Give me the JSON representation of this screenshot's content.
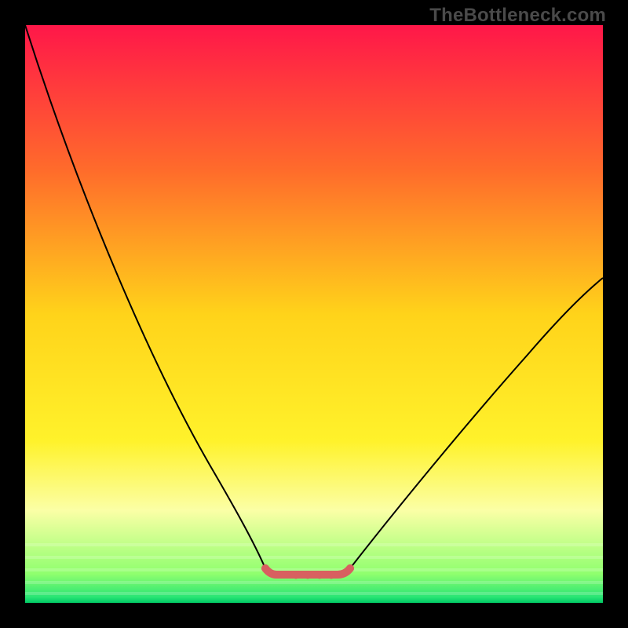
{
  "watermark": "TheBottleneck.com",
  "chart_data": {
    "type": "line",
    "title": "",
    "xlabel": "",
    "ylabel": "",
    "xlim": [
      0,
      1
    ],
    "ylim": [
      0,
      1
    ],
    "grid": false,
    "legend": false,
    "background": {
      "type": "vertical-gradient",
      "stops": [
        {
          "offset": 0.0,
          "color": "#ff1749"
        },
        {
          "offset": 0.25,
          "color": "#ff6b2b"
        },
        {
          "offset": 0.5,
          "color": "#ffd31a"
        },
        {
          "offset": 0.72,
          "color": "#fff22b"
        },
        {
          "offset": 0.84,
          "color": "#fbffa6"
        },
        {
          "offset": 0.96,
          "color": "#8fff6e"
        },
        {
          "offset": 1.0,
          "color": "#00e06a"
        }
      ]
    },
    "series": [
      {
        "name": "left-descent",
        "color": "#000000",
        "width": 2,
        "x": [
          0.0,
          0.415
        ],
        "y": [
          1.0,
          0.06
        ],
        "curvature": "slightly-convex"
      },
      {
        "name": "dip-floor",
        "color": "#d86060",
        "width": 10,
        "x": [
          0.415,
          0.56
        ],
        "y": [
          0.06,
          0.06
        ],
        "note": "flat bottom segment drawn as thick red-pink dashed line with end bumps"
      },
      {
        "name": "right-ascent",
        "color": "#000000",
        "width": 2,
        "x": [
          0.56,
          1.0
        ],
        "y": [
          0.06,
          0.56
        ],
        "curvature": "slightly-convex"
      }
    ],
    "annotations": []
  }
}
